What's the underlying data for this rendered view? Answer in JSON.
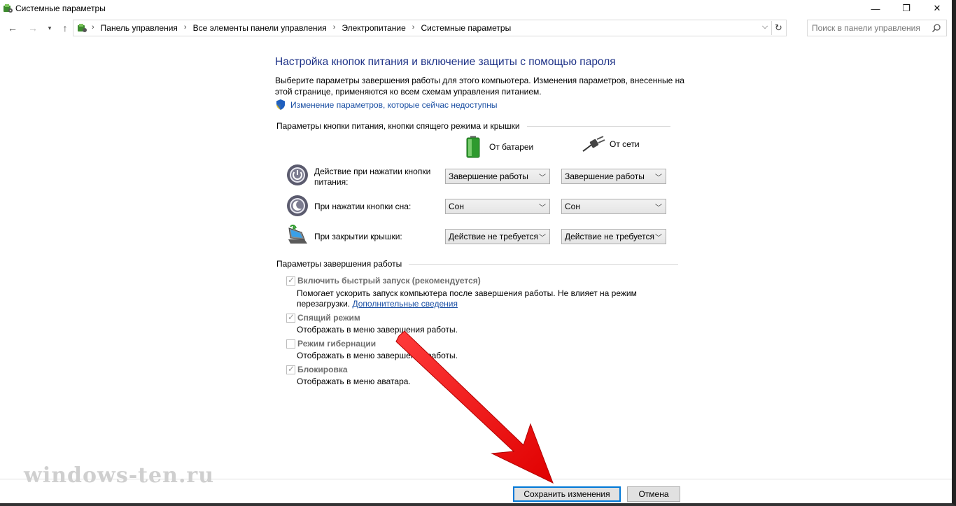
{
  "window": {
    "title": "Системные параметры",
    "minimize": "—",
    "maximize": "❐",
    "close": "✕"
  },
  "nav": {
    "breadcrumbs": [
      "Панель управления",
      "Все элементы панели управления",
      "Электропитание",
      "Системные параметры"
    ],
    "search_placeholder": "Поиск в панели управления"
  },
  "page": {
    "heading": "Настройка кнопок питания и включение защиты с помощью пароля",
    "description": "Выберите параметры завершения работы для этого компьютера. Изменения параметров, внесенные на этой странице, применяются ко всем схемам управления питанием.",
    "change_link": "Изменение параметров, которые сейчас недоступны"
  },
  "power_buttons": {
    "group_title": "Параметры кнопки питания, кнопки спящего режима и крышки",
    "col_battery": "От батареи",
    "col_plugged": "От сети",
    "rows": [
      {
        "label": "Действие при нажатии кнопки питания:",
        "battery": "Завершение работы",
        "plugged": "Завершение работы"
      },
      {
        "label": "При нажатии кнопки сна:",
        "battery": "Сон",
        "plugged": "Сон"
      },
      {
        "label": "При закрытии крышки:",
        "battery": "Действие не требуется",
        "plugged": "Действие не требуется"
      }
    ]
  },
  "shutdown": {
    "group_title": "Параметры завершения работы",
    "options": [
      {
        "label": "Включить быстрый запуск (рекомендуется)",
        "checked": true,
        "desc": "Помогает ускорить запуск компьютера после завершения работы. Не влияет на режим перезагрузки.",
        "link": "Дополнительные сведения"
      },
      {
        "label": "Спящий режим",
        "checked": true,
        "desc": "Отображать в меню завершения работы."
      },
      {
        "label": "Режим гибернации",
        "checked": false,
        "desc": "Отображать в меню завершения работы."
      },
      {
        "label": "Блокировка",
        "checked": true,
        "desc": "Отображать в меню аватара."
      }
    ]
  },
  "buttons": {
    "save": "Сохранить изменения",
    "cancel": "Отмена"
  },
  "watermark": "windows-ten.ru",
  "colors": {
    "heading": "#1e3287",
    "link": "#1a4fa3",
    "annotation_arrow": "#ff1a1a"
  }
}
